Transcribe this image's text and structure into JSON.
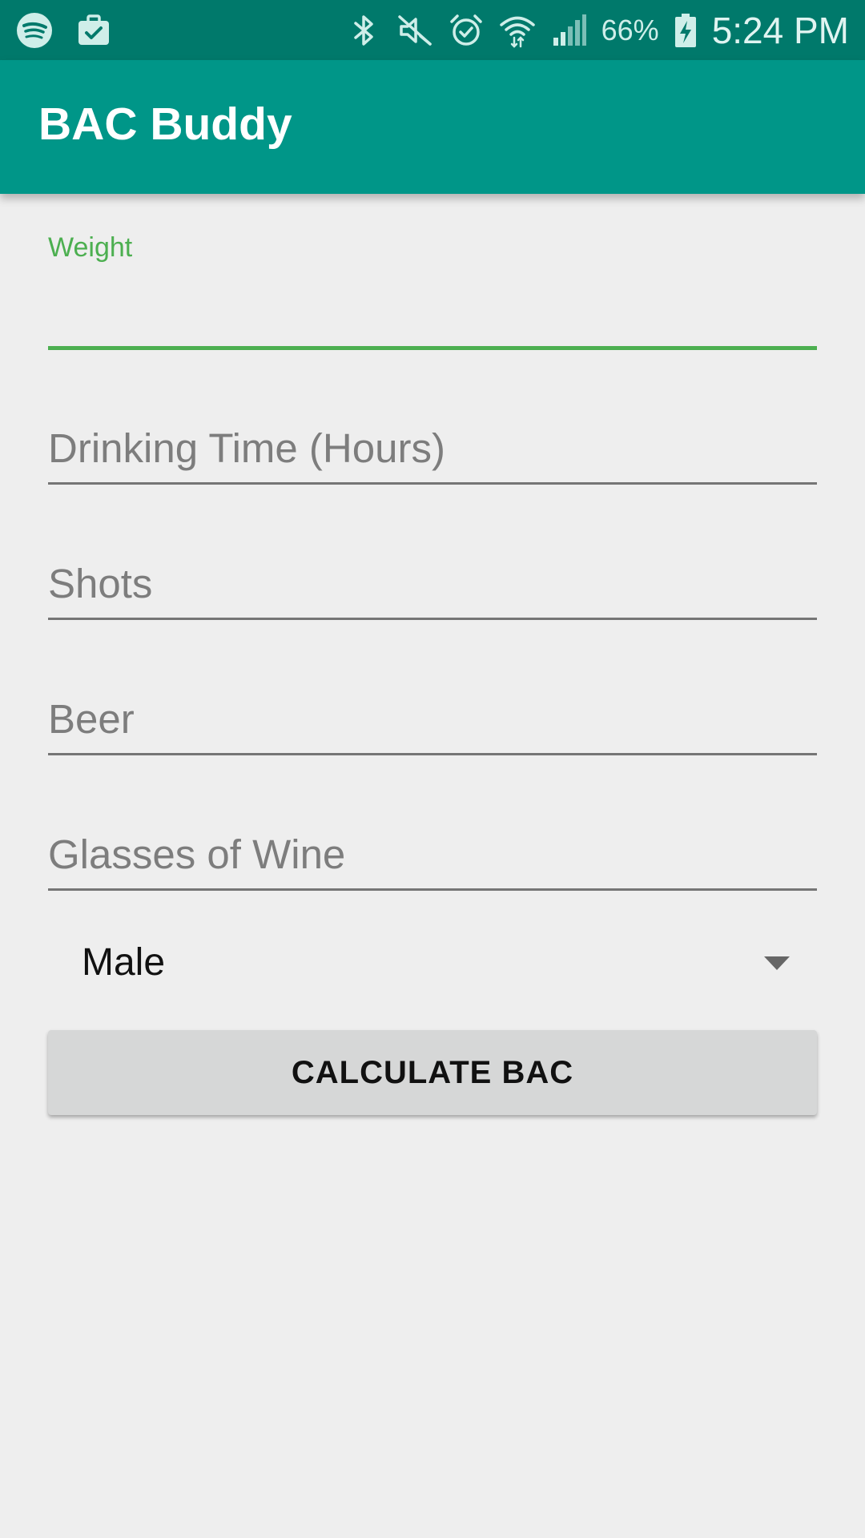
{
  "status_bar": {
    "left_icons": [
      "spotify-icon",
      "briefcase-check-icon"
    ],
    "right_icons": [
      "bluetooth-icon",
      "vibrate-off-icon",
      "alarm-icon",
      "wifi-icon",
      "cellular-signal-icon"
    ],
    "battery_percent": "66%",
    "battery_icon": "battery-charging-icon",
    "time": "5:24 PM",
    "background_color": "#00796b"
  },
  "app_bar": {
    "title": "BAC Buddy",
    "background_color": "#009688"
  },
  "form": {
    "weight": {
      "label": "Weight",
      "value": "",
      "focused": true,
      "accent_color": "#4caf50"
    },
    "drinking_time": {
      "placeholder": "Drinking Time (Hours)",
      "value": ""
    },
    "shots": {
      "placeholder": "Shots",
      "value": ""
    },
    "beer": {
      "placeholder": "Beer",
      "value": ""
    },
    "wine": {
      "placeholder": "Glasses of Wine",
      "value": ""
    },
    "gender_spinner": {
      "selected": "Male",
      "icon": "dropdown-arrow-icon"
    },
    "calculate_button": {
      "label": "CALCULATE BAC"
    }
  }
}
